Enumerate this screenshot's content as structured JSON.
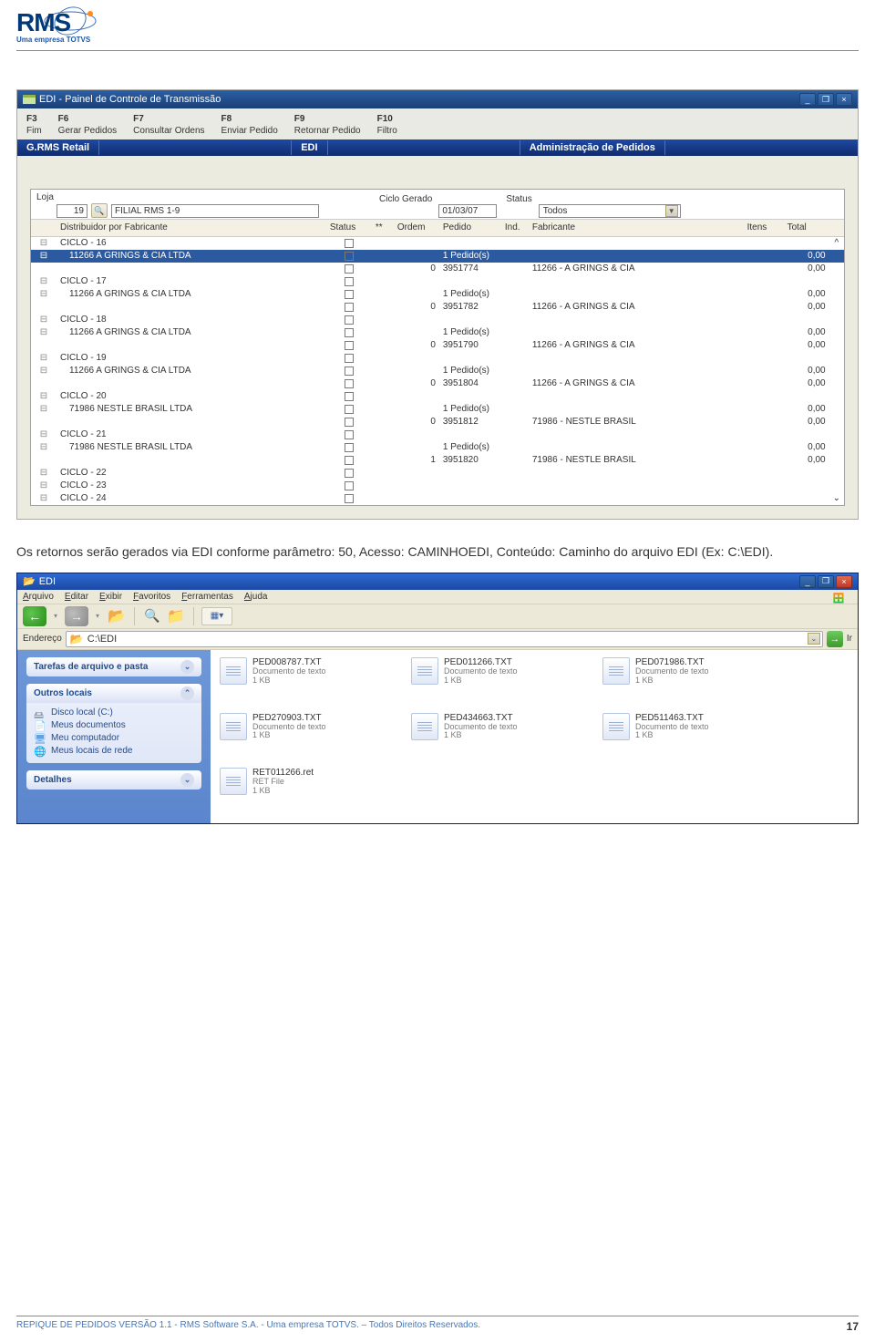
{
  "header": {
    "logo": "RMS",
    "subtitle": "Uma empresa TOTVS"
  },
  "shot1": {
    "title": "EDI - Painel de Controle de Transmissão",
    "fkeys": [
      {
        "key": "F3",
        "label": "Fim"
      },
      {
        "key": "F6",
        "label": "Gerar Pedidos"
      },
      {
        "key": "F7",
        "label": "Consultar Ordens"
      },
      {
        "key": "F8",
        "label": "Enviar Pedido"
      },
      {
        "key": "F9",
        "label": "Retornar Pedido"
      },
      {
        "key": "F10",
        "label": "Filtro"
      }
    ],
    "crumbs": [
      "G.RMS Retail",
      "EDI",
      "Administração de Pedidos"
    ],
    "fields": {
      "loja_label": "Loja",
      "loja_num": "19",
      "loja_name": "FILIAL RMS 1-9",
      "ciclo_label": "Ciclo Gerado",
      "ciclo_value": "01/03/07",
      "status_label": "Status",
      "status_value": "Todos"
    },
    "cols": [
      "",
      "Distribuidor por Fabricante",
      "Status",
      "**",
      "Ordem",
      "Pedido",
      "Ind.",
      "Fabricante",
      "Itens",
      "Total",
      ""
    ],
    "rows": [
      {
        "lvl": "c",
        "txt": "CICLO - 16"
      },
      {
        "lvl": "d",
        "txt": "11266 A GRINGS & CIA LTDA",
        "ped": "1 Pedido(s)",
        "tot": "0,00",
        "sel": true
      },
      {
        "lvl": "i",
        "ord": "0",
        "pedn": "3951774",
        "fab": "11266 - A GRINGS & CIA",
        "tot": "0,00"
      },
      {
        "lvl": "c",
        "txt": "CICLO - 17"
      },
      {
        "lvl": "d",
        "txt": "11266 A GRINGS & CIA LTDA",
        "ped": "1 Pedido(s)",
        "tot": "0,00"
      },
      {
        "lvl": "i",
        "ord": "0",
        "pedn": "3951782",
        "fab": "11266 - A GRINGS & CIA",
        "tot": "0,00"
      },
      {
        "lvl": "c",
        "txt": "CICLO - 18"
      },
      {
        "lvl": "d",
        "txt": "11266 A GRINGS & CIA LTDA",
        "ped": "1 Pedido(s)",
        "tot": "0,00"
      },
      {
        "lvl": "i",
        "ord": "0",
        "pedn": "3951790",
        "fab": "11266 - A GRINGS & CIA",
        "tot": "0,00"
      },
      {
        "lvl": "c",
        "txt": "CICLO - 19"
      },
      {
        "lvl": "d",
        "txt": "11266 A GRINGS & CIA LTDA",
        "ped": "1 Pedido(s)",
        "tot": "0,00"
      },
      {
        "lvl": "i",
        "ord": "0",
        "pedn": "3951804",
        "fab": "11266 - A GRINGS & CIA",
        "tot": "0,00"
      },
      {
        "lvl": "c",
        "txt": "CICLO - 20"
      },
      {
        "lvl": "d",
        "txt": "71986 NESTLE BRASIL LTDA",
        "ped": "1 Pedido(s)",
        "tot": "0,00"
      },
      {
        "lvl": "i",
        "ord": "0",
        "pedn": "3951812",
        "fab": "71986 - NESTLE BRASIL",
        "tot": "0,00"
      },
      {
        "lvl": "c",
        "txt": "CICLO - 21"
      },
      {
        "lvl": "d",
        "txt": "71986 NESTLE BRASIL LTDA",
        "ped": "1 Pedido(s)",
        "tot": "0,00"
      },
      {
        "lvl": "i",
        "ord": "1",
        "pedn": "3951820",
        "fab": "71986 - NESTLE BRASIL",
        "tot": "0,00"
      },
      {
        "lvl": "c",
        "txt": "CICLO - 22"
      },
      {
        "lvl": "c",
        "txt": "CICLO - 23"
      },
      {
        "lvl": "c",
        "txt": "CICLO - 24"
      }
    ]
  },
  "paragraph": "Os retornos serão gerados via EDI conforme parâmetro: 50, Acesso: CAMINHOEDI, Conteúdo: Caminho do arquivo EDI (Ex: C:\\EDI).",
  "explorer": {
    "title": "EDI",
    "menu": [
      "Arquivo",
      "Editar",
      "Exibir",
      "Favoritos",
      "Ferramentas",
      "Ajuda"
    ],
    "addr_label": "Endereço",
    "addr_value": "C:\\EDI",
    "go_label": "Ir",
    "task1": {
      "title": "Tarefas de arquivo e pasta"
    },
    "task2": {
      "title": "Outros locais",
      "items": [
        {
          "ico": "drv",
          "label": "Disco local (C:)"
        },
        {
          "ico": "doc",
          "label": "Meus documentos"
        },
        {
          "ico": "comp",
          "label": "Meu computador"
        },
        {
          "ico": "net",
          "label": "Meus locais de rede"
        }
      ]
    },
    "task3": {
      "title": "Detalhes"
    },
    "files": [
      {
        "name": "PED008787.TXT",
        "type": "Documento de texto",
        "size": "1 KB"
      },
      {
        "name": "PED011266.TXT",
        "type": "Documento de texto",
        "size": "1 KB"
      },
      {
        "name": "PED071986.TXT",
        "type": "Documento de texto",
        "size": "1 KB"
      },
      {
        "name": "PED270903.TXT",
        "type": "Documento de texto",
        "size": "1 KB"
      },
      {
        "name": "PED434663.TXT",
        "type": "Documento de texto",
        "size": "1 KB"
      },
      {
        "name": "PED511463.TXT",
        "type": "Documento de texto",
        "size": "1 KB"
      },
      {
        "name": "RET011266.ret",
        "type": "RET File",
        "size": "1 KB"
      }
    ]
  },
  "footer": {
    "text": "REPIQUE DE PEDIDOS VERSÃO 1.1 - RMS Software S.A.  - Uma empresa TOTVS. – Todos Direitos Reservados.",
    "page": "17"
  }
}
